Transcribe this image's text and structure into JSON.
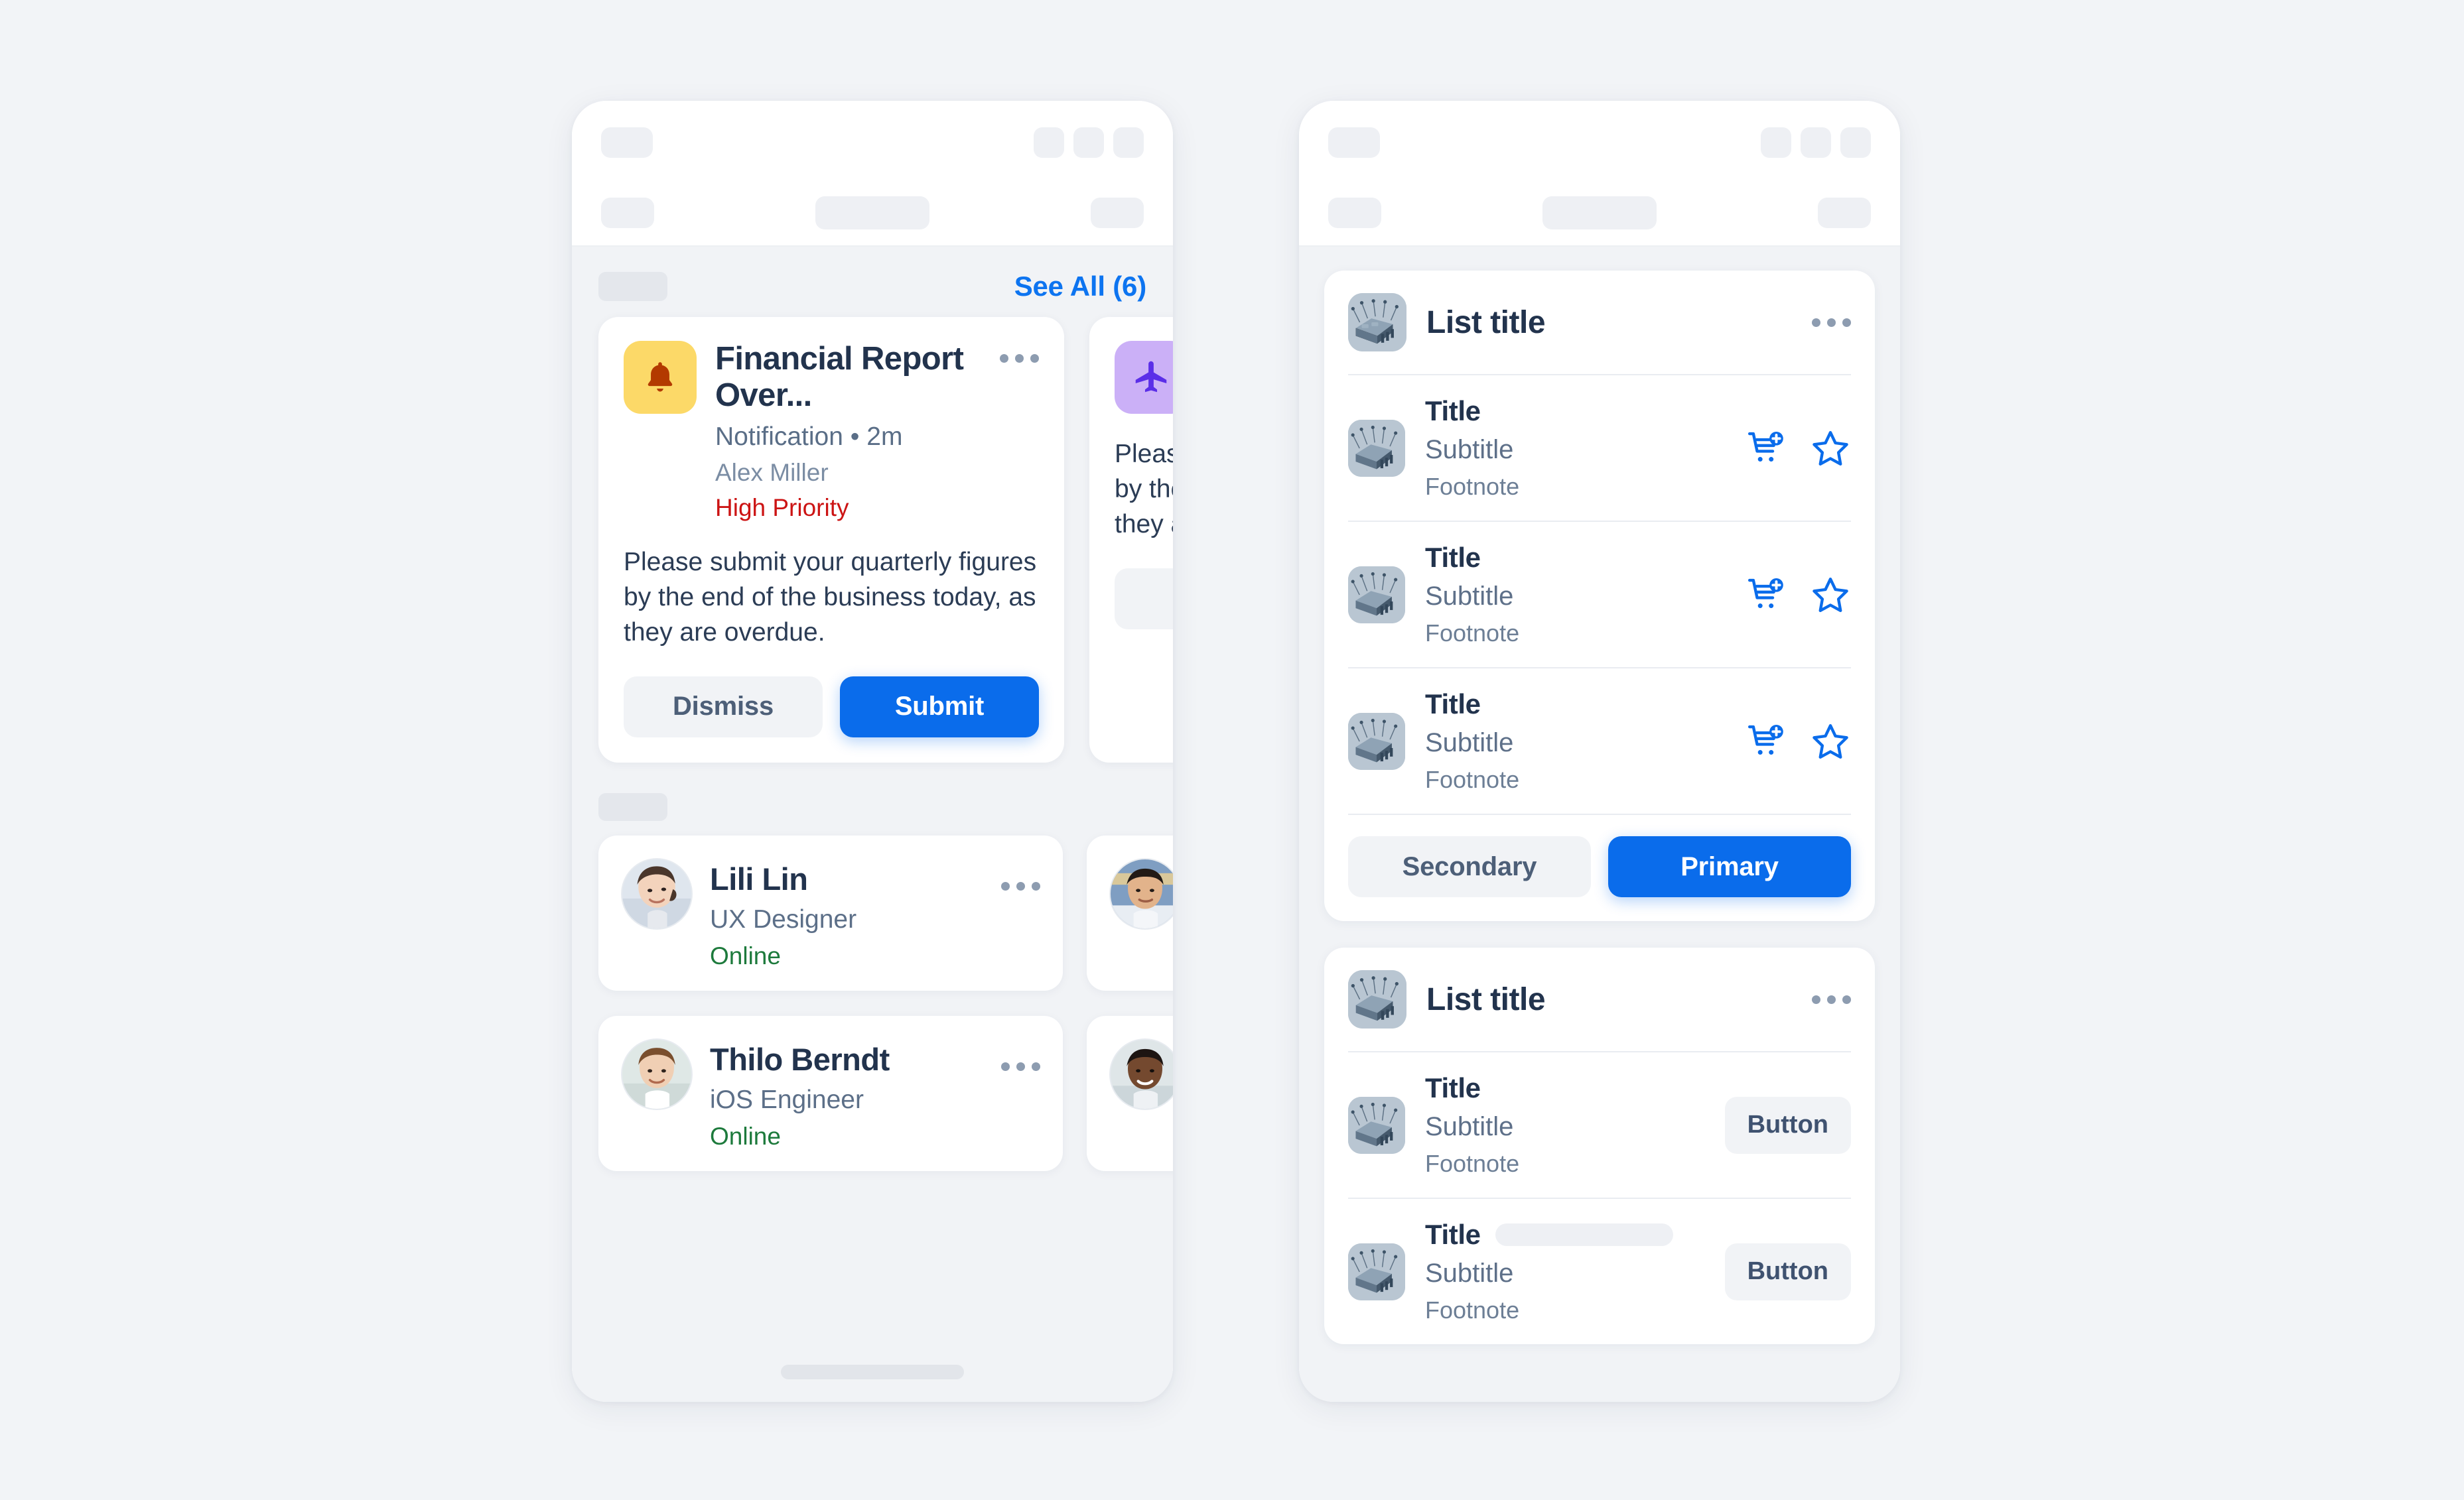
{
  "page": {
    "background": "#f2f4f7",
    "accent_blue": "#0a6ceb",
    "link_blue": "#0d74f0",
    "danger_red": "#cc1414",
    "online_green": "#1d7a3c"
  },
  "left_phone": {
    "notifications_section": {
      "see_all_label": "See All (6)"
    },
    "notification_cards": [
      {
        "icon": "bell-icon",
        "badge_color": "#fcd968",
        "title": "Financial Report Over...",
        "meta": "Notification • 2m",
        "person": "Alex Miller",
        "priority": "High Priority",
        "body": "Please submit your quarterly figures by the end of the business today, as they are overdue.",
        "dismiss_label": "Dismiss",
        "submit_label": "Submit"
      },
      {
        "icon": "airplane-icon",
        "badge_color": "#cbb0f7",
        "title": "",
        "meta": "",
        "person": "",
        "priority": "",
        "body": "Please submit your quarterly figures by the end of the business today, as they are overdue.",
        "dismiss_label": "",
        "submit_label": ""
      }
    ],
    "contacts": [
      {
        "name": "Lili Lin",
        "role": "UX Designer",
        "status": "Online",
        "avatar": "avatar-woman-asian"
      },
      {
        "name": "Thilo Berndt",
        "role": "iOS Engineer",
        "status": "Online",
        "avatar": "avatar-man-brown-hair"
      }
    ],
    "contacts_partial": [
      {
        "avatar": "avatar-man-asian"
      },
      {
        "avatar": "avatar-man-black"
      }
    ]
  },
  "right_phone": {
    "list_cards": [
      {
        "header_title": "List title",
        "header_icon": "more-horizontal-icon",
        "thumbnail": "tech-isometric-thumbnail",
        "rows": [
          {
            "title": "Title",
            "subtitle": "Subtitle",
            "footnote": "Footnote",
            "action_type": "icons",
            "icons": [
              "cart-plus-icon",
              "star-outline-icon"
            ]
          },
          {
            "title": "Title",
            "subtitle": "Subtitle",
            "footnote": "Footnote",
            "action_type": "icons",
            "icons": [
              "cart-plus-icon",
              "star-outline-icon"
            ]
          },
          {
            "title": "Title",
            "subtitle": "Subtitle",
            "footnote": "Footnote",
            "action_type": "icons",
            "icons": [
              "cart-plus-icon",
              "star-outline-icon"
            ]
          }
        ],
        "footer_buttons": {
          "secondary_label": "Secondary",
          "primary_label": "Primary"
        }
      },
      {
        "header_title": "List title",
        "header_icon": "more-horizontal-icon",
        "thumbnail": "tech-isometric-thumbnail",
        "rows": [
          {
            "title": "Title",
            "subtitle": "Subtitle",
            "footnote": "Footnote",
            "action_type": "button",
            "button_label": "Button",
            "skeleton": false
          },
          {
            "title": "Title",
            "subtitle": "Subtitle",
            "footnote": "Footnote",
            "action_type": "button",
            "button_label": "Button",
            "skeleton": true
          }
        ],
        "footer_buttons": null
      }
    ]
  }
}
